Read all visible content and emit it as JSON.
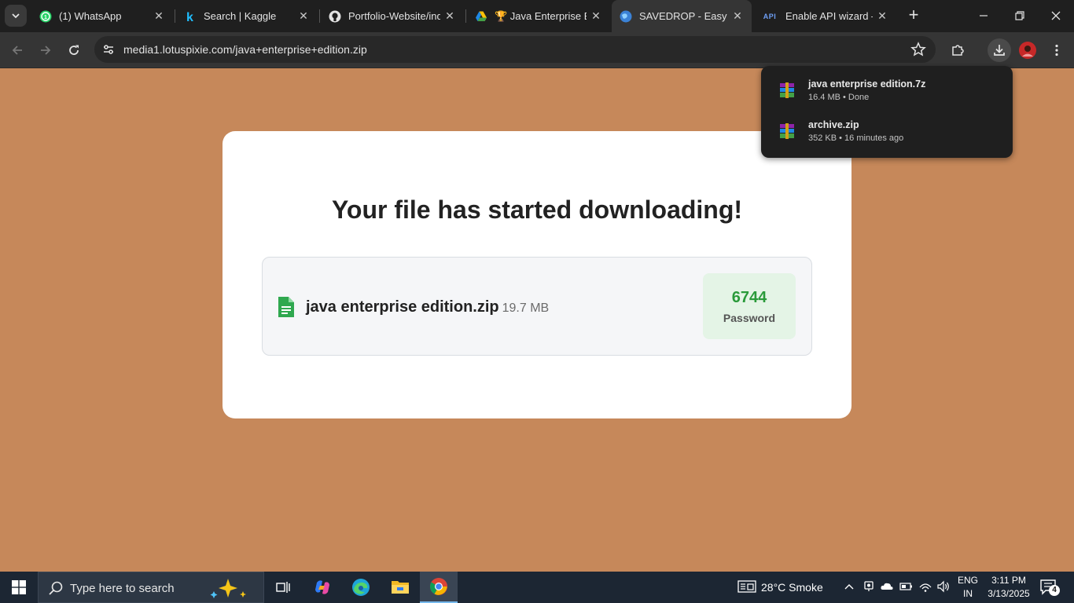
{
  "browser": {
    "tabs": [
      {
        "title": "(1) WhatsApp",
        "favicon": "whatsapp-icon"
      },
      {
        "title": "Search | Kaggle",
        "favicon": "kaggle-icon"
      },
      {
        "title": "Portfolio-Website/ind",
        "favicon": "github-icon"
      },
      {
        "title": "🏆 Java Enterprise Ed",
        "favicon": "google-drive-icon"
      },
      {
        "title": "SAVEDROP - Easy and",
        "favicon": "globe-icon",
        "active": true
      },
      {
        "title": "Enable API wizard – A",
        "favicon": "api-icon"
      }
    ],
    "api_favicon_text": "API",
    "url": "media1.lotuspixie.com/java+enterprise+edition.zip"
  },
  "downloads": {
    "items": [
      {
        "name": "java enterprise edition.7z",
        "meta": "16.4 MB • Done"
      },
      {
        "name": "archive.zip",
        "meta": "352 KB • 16 minutes ago"
      }
    ]
  },
  "page": {
    "heading": "Your file has started downloading!",
    "file_name": "java enterprise edition.zip",
    "file_size": "19.7 MB",
    "password": "6744",
    "password_label": "Password"
  },
  "taskbar": {
    "search_placeholder": "Type here to search",
    "weather": "28°C  Smoke",
    "lang_line1": "ENG",
    "lang_line2": "IN",
    "time": "3:11 PM",
    "date": "3/13/2025",
    "notification_count": "4"
  },
  "colors": {
    "page_background": "#c6885a",
    "password_green": "#2a9a3a",
    "browser_dark": "#1f1f1f"
  }
}
